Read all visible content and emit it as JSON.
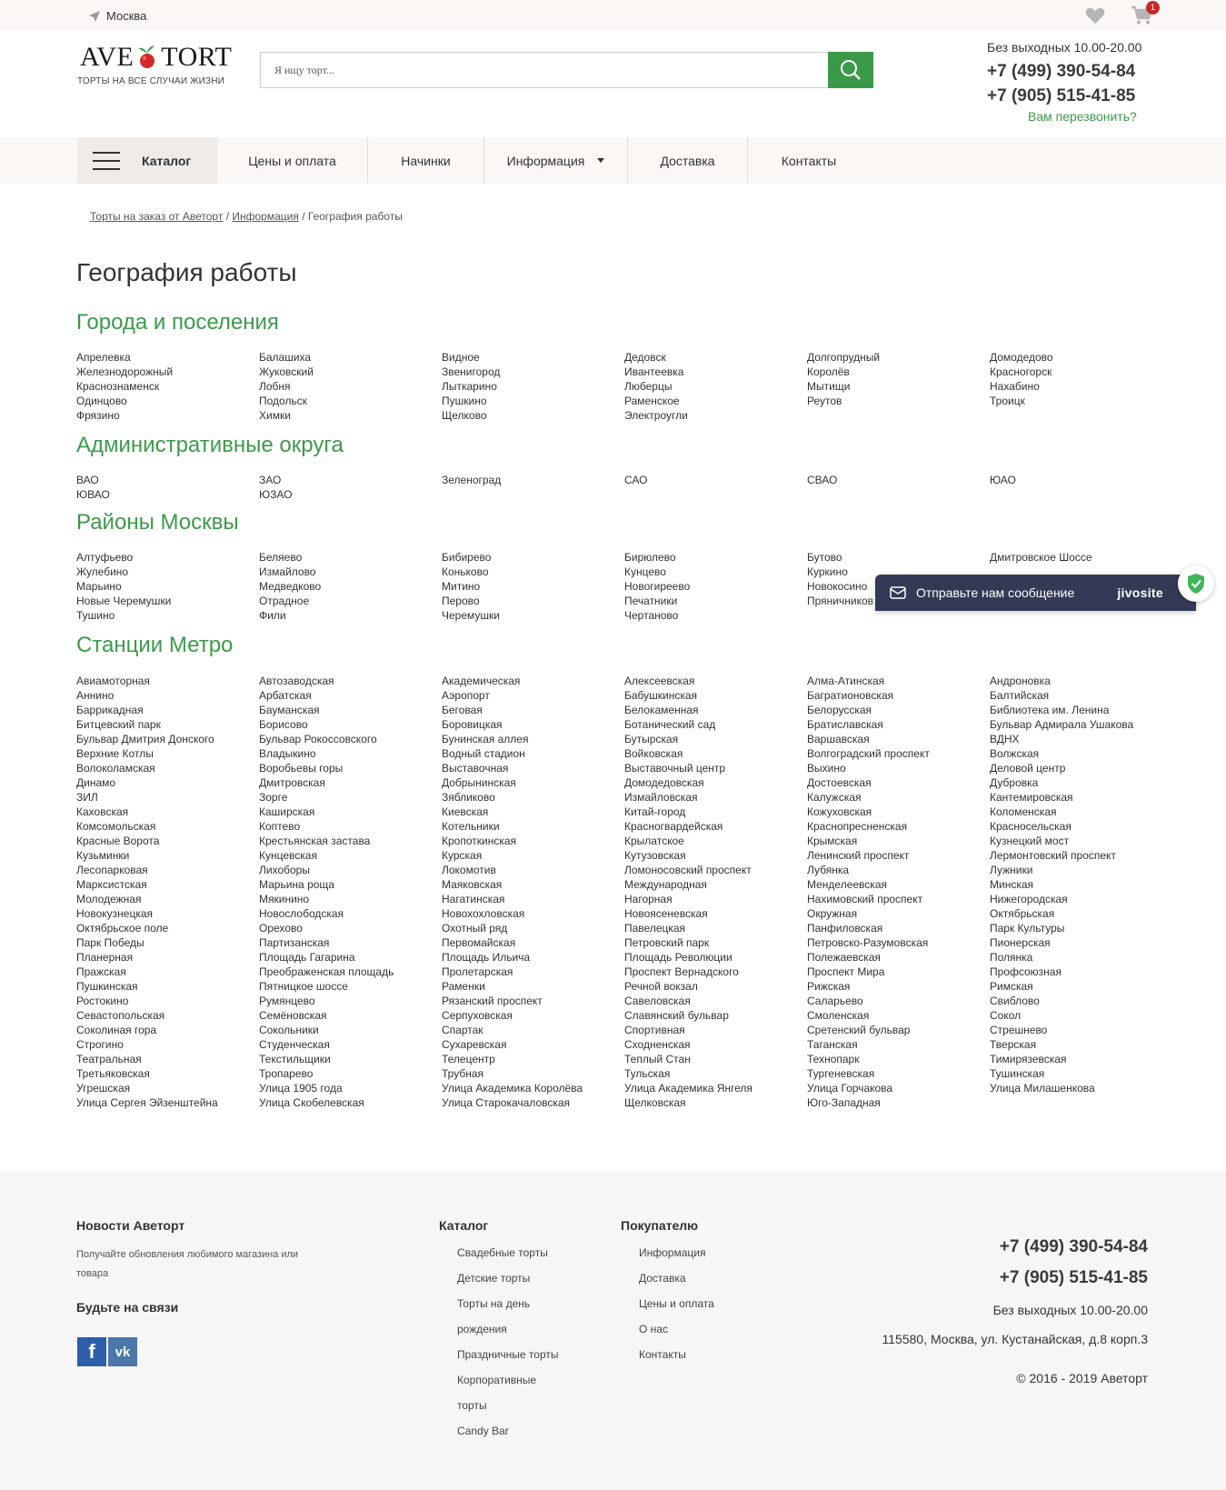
{
  "topbar": {
    "city": "Москва",
    "cart_count": "1"
  },
  "header": {
    "logo_left": "AVE",
    "logo_right": "TORT",
    "tagline": "ТОРТЫ НА ВСЕ СЛУЧАИ ЖИЗНИ",
    "search_placeholder": "Я ищу торт...",
    "hours": "Без выходных 10.00-20.00",
    "phone1": "+7 (499) 390-54-84",
    "phone2": "+7 (905) 515-41-85",
    "callback": "Вам перезвонить?"
  },
  "nav": {
    "catalog": "Каталог",
    "items": [
      "Цены и оплата",
      "Начинки",
      "Информация",
      "Доставка",
      "Контакты"
    ]
  },
  "breadcrumb": {
    "home": "Торты на заказ от Аветорт",
    "sep": "/",
    "info": "Информация",
    "current": "География работы"
  },
  "page_title": "География работы",
  "sections": {
    "cities": {
      "title": "Города и поселения",
      "columns": [
        [
          "Апрелевка",
          "Железнодорожный",
          "Краснознаменск",
          "Одинцово",
          "Фрязино"
        ],
        [
          "Балашиха",
          "Жуковский",
          "Лобня",
          "Подольск",
          "Химки"
        ],
        [
          "Видное",
          "Звенигород",
          "Лыткарино",
          "Пушкино",
          "Щелково"
        ],
        [
          "Дедовск",
          "Ивантеевка",
          "Люберцы",
          "Раменское",
          "Электроугли"
        ],
        [
          "Долгопрудный",
          "Королёв",
          "Мытищи",
          "Реутов"
        ],
        [
          "Домодедово",
          "Красногорск",
          "Нахабино",
          "Троицк"
        ]
      ]
    },
    "districts": {
      "title": "Административные округа",
      "columns": [
        [
          "ВАО",
          "ЮВАО"
        ],
        [
          "ЗАО",
          "ЮЗАО"
        ],
        [
          "Зеленоград"
        ],
        [
          "САО"
        ],
        [
          "СВАО"
        ],
        [
          "ЮАО"
        ]
      ]
    },
    "areas": {
      "title": "Районы Москвы",
      "columns": [
        [
          "Алтуфьево",
          "Жулебино",
          "Марьино",
          "Новые Черемушки",
          "Тушино"
        ],
        [
          "Беляево",
          "Измайлово",
          "Медведково",
          "Отрадное",
          "Фили"
        ],
        [
          "Бибирево",
          "Коньково",
          "Митино",
          "Перово",
          "Черемушки"
        ],
        [
          "Бирюлево",
          "Кунцево",
          "Новогиреево",
          "Печатники",
          "Чертаново"
        ],
        [
          "Бутово",
          "Куркино",
          "Новокосино",
          "Пряничников"
        ],
        [
          "Дмитровское Шоссе"
        ]
      ]
    },
    "metro": {
      "title": "Станции Метро",
      "columns": [
        [
          "Авиамоторная",
          "Аннино",
          "Баррикадная",
          "Битцевский парк",
          "Бульвар Дмитрия Донского",
          "Верхние Котлы",
          "Волоколамская",
          "Динамо",
          "ЗИЛ",
          "Каховская",
          "Комсомольская",
          "Красные Ворота",
          "Кузьминки",
          "Лесопарковая",
          "Марксистская",
          "Молодежная",
          "Новокузнецкая",
          "Октябрьское поле",
          "Парк Победы",
          "Планерная",
          "Пражская",
          "Пушкинская",
          "Ростокино",
          "Севастопольская",
          "Соколиная гора",
          "Строгино",
          "Театральная",
          "Третьяковская",
          "Угрешская",
          "Улица Сергея Эйзенштейна"
        ],
        [
          "Автозаводская",
          "Арбатская",
          "Бауманская",
          "Борисово",
          "Бульвар Рокоссовского",
          "Владыкино",
          "Воробьевы горы",
          "Дмитровская",
          "Зорге",
          "Каширская",
          "Коптево",
          "Крестьянская застава",
          "Кунцевская",
          "Лихоборы",
          "Марьина роща",
          "Мякинино",
          "Новослободская",
          "Орехово",
          "Партизанская",
          "Площадь Гагарина",
          "Преображенская площадь",
          "Пятницкое шоссе",
          "Румянцево",
          "Семёновская",
          "Сокольники",
          "Студенческая",
          "Текстильщики",
          "Тропарево",
          "Улица 1905 года",
          "Улица Скобелевская"
        ],
        [
          "Академическая",
          "Аэропорт",
          "Беговая",
          "Боровицкая",
          "Бунинская аллея",
          "Водный стадион",
          "Выставочная",
          "Добрынинская",
          "Зябликово",
          "Киевская",
          "Котельники",
          "Кропоткинская",
          "Курская",
          "Локомотив",
          "Маяковская",
          "Нагатинская",
          "Новохохловская",
          "Охотный ряд",
          "Первомайская",
          "Площадь Ильича",
          "Пролетарская",
          "Раменки",
          "Рязанский проспект",
          "Серпуховская",
          "Спартак",
          "Сухаревская",
          "Телецентр",
          "Трубная",
          "Улица Академика Королёва",
          "Улица Старокачаловская"
        ],
        [
          "Алексеевская",
          "Бабушкинская",
          "Белокаменная",
          "Ботанический сад",
          "Бутырская",
          "Войковская",
          "Выставочный центр",
          "Домодедовская",
          "Измайловская",
          "Китай-город",
          "Красногвардейская",
          "Крылатское",
          "Кутузовская",
          "Ломоносовский проспект",
          "Международная",
          "Нагорная",
          "Новоясеневская",
          "Павелецкая",
          "Петровский парк",
          "Площадь Революции",
          "Проспект Вернадского",
          "Речной вокзал",
          "Савеловская",
          "Славянский бульвар",
          "Спортивная",
          "Сходненская",
          "Теплый Стан",
          "Тульская",
          "Улица Академика Янгеля",
          "Щелковская"
        ],
        [
          "Алма-Атинская",
          "Багратионовская",
          "Белорусская",
          "Братиславская",
          "Варшавская",
          "Волгоградский проспект",
          "Выхино",
          "Достоевская",
          "Калужская",
          "Кожуховская",
          "Краснопресненская",
          "Крымская",
          "Ленинский проспект",
          "Лубянка",
          "Менделеевская",
          "Нахимовский проспект",
          "Окружная",
          "Панфиловская",
          "Петровско-Разумовская",
          "Полежаевская",
          "Проспект Мира",
          "Рижская",
          "Саларьево",
          "Смоленская",
          "Сретенский бульвар",
          "Таганская",
          "Технопарк",
          "Тургеневская",
          "Улица Горчакова",
          "Юго-Западная"
        ],
        [
          "Андроновка",
          "Балтийская",
          "Библиотека им. Ленина",
          "Бульвар Адмирала Ушакова",
          "ВДНХ",
          "Волжская",
          "Деловой центр",
          "Дубровка",
          "Кантемировская",
          "Коломенская",
          "Красносельская",
          "Кузнецкий мост",
          "Лермонтовский проспект",
          "Лужники",
          "Минская",
          "Нижегородская",
          "Октябрьская",
          "Парк Культуры",
          "Пионерская",
          "Полянка",
          "Профсоюзная",
          "Римская",
          "Свиблово",
          "Сокол",
          "Стрешнево",
          "Тверская",
          "Тимирязевская",
          "Тушинская",
          "Улица Милашенкова"
        ]
      ]
    }
  },
  "chat": {
    "label": "Отправьте нам сообщение",
    "brand": "jivosite"
  },
  "footer": {
    "news_title": "Новости Аветорт",
    "news_text": "Получайте обновления любимого магазина или товара",
    "social_title": "Будьте на связи",
    "catalog_title": "Каталог",
    "catalog_items": [
      "Свадебные торты",
      "Детские торты",
      "Торты на день рождения",
      "Праздничные торты",
      "Корпоративные торты",
      "Candy Bar"
    ],
    "buyer_title": "Покупателю",
    "buyer_items": [
      "Информация",
      "Доставка",
      "Цены и оплата",
      "О нас",
      "Контакты"
    ],
    "phone1": "+7 (499) 390-54-84",
    "phone2": "+7 (905) 515-41-85",
    "hours": "Без выходных 10.00-20.00",
    "address": "115580, Москва, ул. Кустанайская, д.8 корп.3",
    "copyright": "© 2016 - 2019 Аветорт"
  }
}
